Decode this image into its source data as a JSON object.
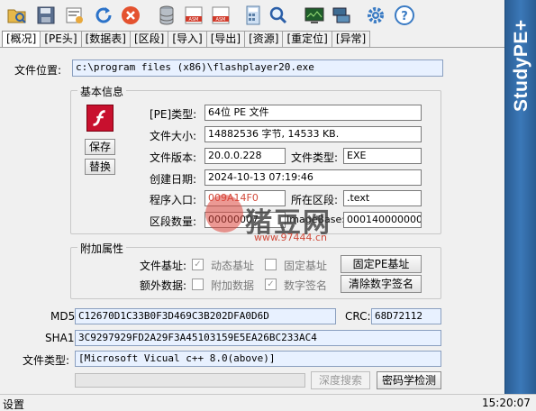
{
  "brand": {
    "text": "StudyPE+"
  },
  "toolbar": {
    "icons": [
      "open-folder-icon",
      "save-icon",
      "view-icon",
      "refresh-icon",
      "close-icon",
      "database-icon",
      "asm-icon",
      "asm2-icon",
      "calculator-icon",
      "search-icon",
      "monitor-icon",
      "network-icon",
      "settings-icon",
      "help-icon"
    ]
  },
  "tabs": [
    "[概况]",
    "[PE头]",
    "[数据表]",
    "[区段]",
    "[导入]",
    "[导出]",
    "[资源]",
    "[重定位]",
    "[异常]"
  ],
  "file": {
    "location_label": "文件位置:",
    "location_value": "c:\\program files (x86)\\flashplayer20.exe"
  },
  "basic_info": {
    "title": "基本信息",
    "save_button": "保存",
    "replace_button": "替换",
    "pe_type_label": "[PE]类型:",
    "pe_type_value": "64位 PE 文件",
    "size_label": "文件大小:",
    "size_value": "14882536 字节, 14533 KB.",
    "version_label": "文件版本:",
    "version_value": "20.0.0.228",
    "filetype_label": "文件类型:",
    "filetype_value": "EXE",
    "created_label": "创建日期:",
    "created_value": "2024-10-13 07:19:46",
    "entry_label": "程序入口:",
    "entry_value": "009A14F0",
    "entry_section_label": "所在区段:",
    "entry_section_value": ".text",
    "section_count_label": "区段数量:",
    "section_count_value": "00000007",
    "imagebase_label": "ImageBase:",
    "imagebase_value": "0001400000000"
  },
  "extra": {
    "title": "附加属性",
    "base_label": "文件基址:",
    "dynamic_base": "动态基址",
    "fixed_base": "固定基址",
    "fix_pe_button": "固定PE基址",
    "extra_data_label": "额外数据:",
    "extra_data": "附加数据",
    "digital_sig": "数字签名",
    "clear_sig_button": "清除数字签名"
  },
  "hashes": {
    "md5_label": "MD5:",
    "md5_value": "C12670D1C33B0F3D469C3B202DFA0D6D",
    "crc_label": "CRC:",
    "crc_value": "68D72112",
    "sha1_label": "SHA1:",
    "sha1_value": "3C9297929FD2A29F3A45103159E5EA26BC233AC4"
  },
  "detect": {
    "type_label": "文件类型:",
    "type_value": "[Microsoft Vicual c++ 8.0(above)]",
    "deep_search_button": "深度搜索",
    "crypto_button": "密码学检测"
  },
  "watermark": {
    "text": "猪豆网",
    "url": "www.97444.cn"
  },
  "status": {
    "left": "设置",
    "time": "15:20:07"
  }
}
